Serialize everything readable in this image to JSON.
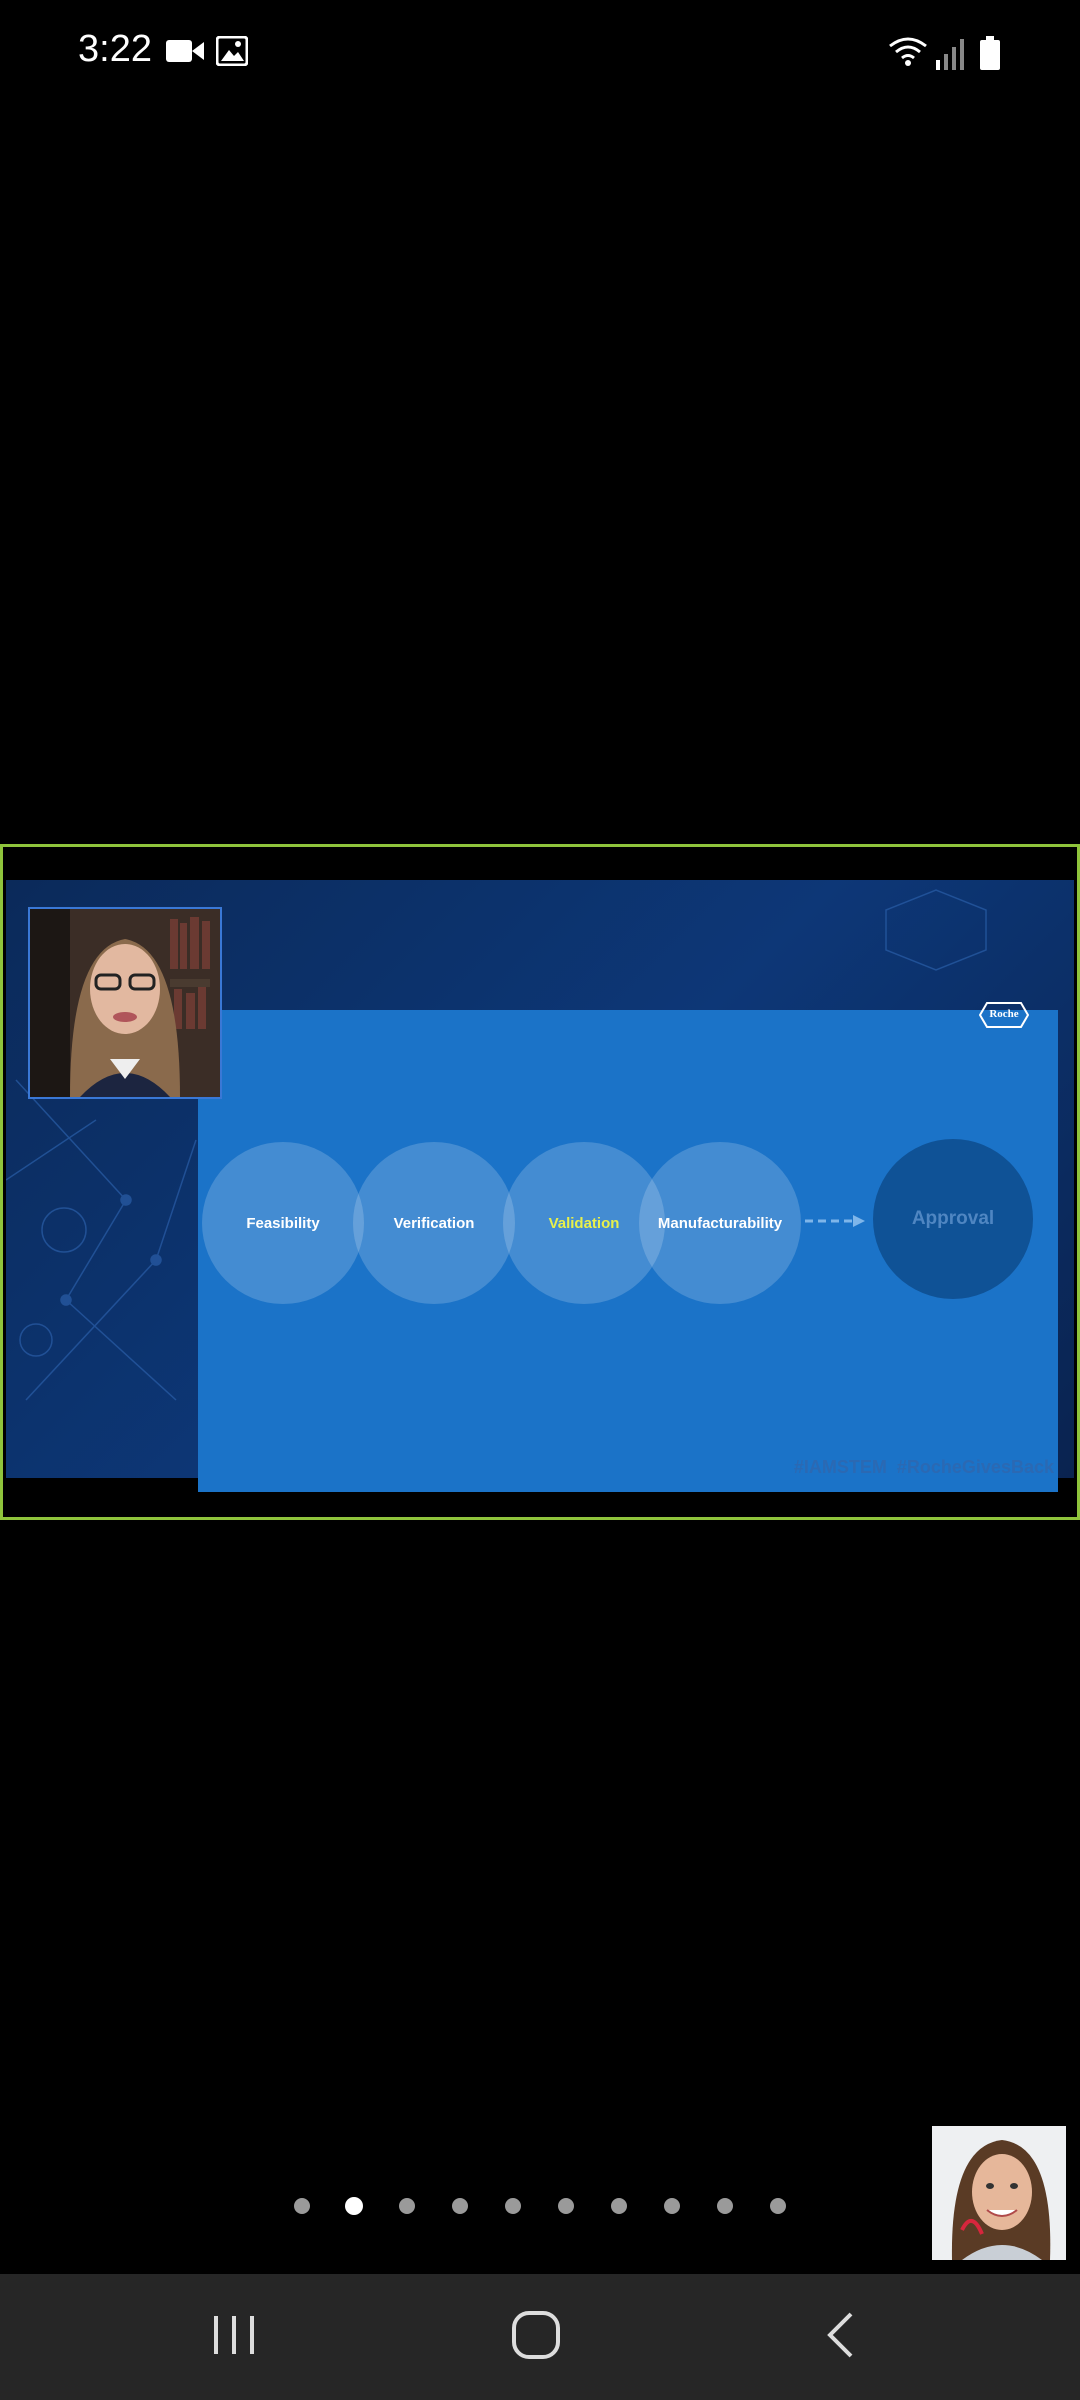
{
  "status_bar": {
    "time": "3:22",
    "left_icons": [
      "video-camera-icon",
      "image-icon"
    ],
    "right_icons": [
      "wifi-icon",
      "signal-icon",
      "battery-icon"
    ]
  },
  "slide": {
    "logo_text": "Roche",
    "stages": [
      "Feasibility",
      "Verification",
      "Validation",
      "Manufacturability"
    ],
    "highlighted_stage": "Validation",
    "final_stage": "Approval",
    "hashtags": "#IAMSTEM  #RocheGivesBack"
  },
  "colors": {
    "active_speaker_border": "#8fc43c",
    "slide_panel": "#1b73c8",
    "highlight_text": "#e8f04a"
  },
  "pagination": {
    "total": 10,
    "active_index": 1
  },
  "nav_bar": {
    "icons": [
      "recent-apps-icon",
      "home-icon",
      "back-icon"
    ]
  }
}
